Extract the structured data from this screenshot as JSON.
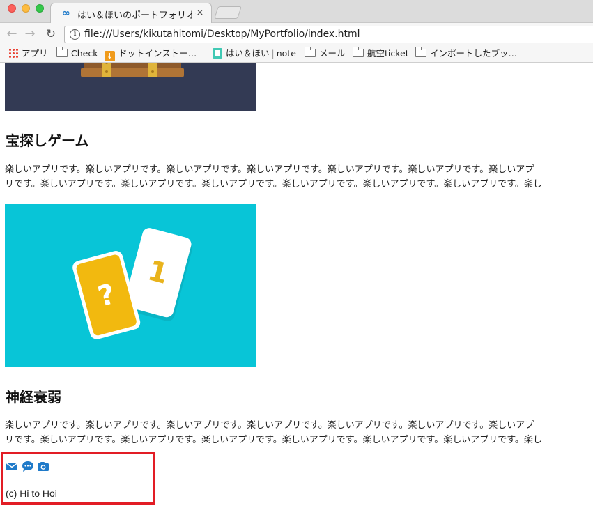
{
  "window": {
    "tab_title": "はい＆ほいのポートフォリオサ",
    "tab_close": "×",
    "url": "file:///Users/kikutahitomi/Desktop/MyPortfolio/index.html"
  },
  "bookmarks": [
    {
      "label": "アプリ",
      "icon": "apps-icon"
    },
    {
      "label": "Check",
      "icon": "folder-icon"
    },
    {
      "label": "ドットインストー…",
      "icon": "download-icon"
    },
    {
      "label": "はい＆ほい",
      "suffix": "note",
      "icon": "note-icon"
    },
    {
      "label": "メール",
      "icon": "folder-icon"
    },
    {
      "label": "航空ticket",
      "icon": "folder-icon"
    },
    {
      "label": "インポートしたブッ…",
      "icon": "folder-icon"
    }
  ],
  "works": [
    {
      "title": "宝探しゲーム",
      "description_line1": "楽しいアプリです。楽しいアプリです。楽しいアプリです。楽しいアプリです。楽しいアプリです。楽しいアプリです。楽しいアプ",
      "description_line2": "リです。楽しいアプリです。楽しいアプリです。楽しいアプリです。楽しいアプリです。楽しいアプリです。楽しいアプリです。楽し"
    },
    {
      "title": "神経衰弱",
      "description_line1": "楽しいアプリです。楽しいアプリです。楽しいアプリです。楽しいアプリです。楽しいアプリです。楽しいアプリです。楽しいアプ",
      "description_line2": "リです。楽しいアプリです。楽しいアプリです。楽しいアプリです。楽しいアプリです。楽しいアプリです。楽しいアプリです。楽し"
    }
  ],
  "card_image": {
    "question_card": "?",
    "number_card": "1"
  },
  "footer": {
    "icons": [
      "mail-icon",
      "chat-icon",
      "camera-icon"
    ],
    "copyright": "(c) Hi to Hoi"
  },
  "colors": {
    "chest_bg": "#333a54",
    "cards_bg": "#08c5d7",
    "icon_blue": "#1f7ac9",
    "highlight_red": "#e21d25"
  }
}
